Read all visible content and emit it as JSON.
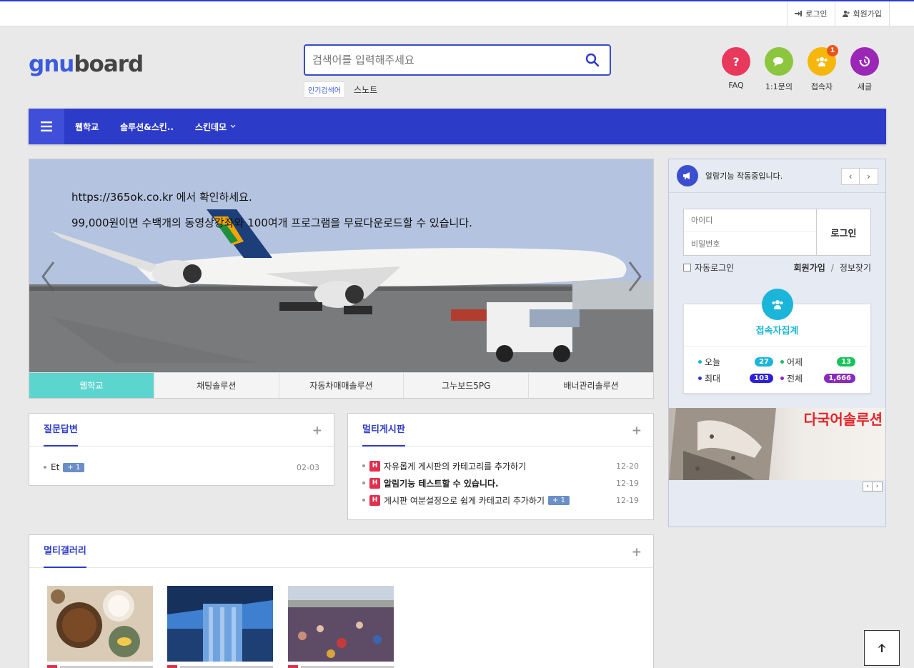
{
  "topbar": {
    "login_label": "로그인",
    "join_label": "회원가입"
  },
  "logo": {
    "part1": "gnu",
    "part2": "board"
  },
  "search": {
    "placeholder": "검색어를 입력해주세요",
    "popular_tag": "인기검색어",
    "popular_word": "스노트"
  },
  "quick_menu": [
    {
      "label": "FAQ",
      "icon": "question-icon",
      "color": "#e8385b"
    },
    {
      "label": "1:1문의",
      "icon": "chat-icon",
      "color": "#8cc63f"
    },
    {
      "label": "접속자",
      "icon": "users-icon",
      "color": "#f5b70c",
      "badge": "1"
    },
    {
      "label": "새글",
      "icon": "history-icon",
      "color": "#9b27b6"
    }
  ],
  "gnb": {
    "items": [
      "웹학교",
      "솔루션&스킨..",
      "스킨데모"
    ]
  },
  "slider": {
    "line1": "https://365ok.co.kr 에서 확인하세요.",
    "line2": "99,000원이면 수백개의 동영상강좌와 100여개 프로그램을 무료다운로드할 수 있습니다.",
    "tabs": [
      "웹학교",
      "채팅솔루션",
      "자동차매매솔루션",
      "그누보드5PG",
      "배너관리솔루션"
    ],
    "active_tab": 0
  },
  "qna": {
    "title": "질문답변",
    "posts": [
      {
        "title": "Et",
        "count": "+ 1",
        "date": "02-03"
      }
    ]
  },
  "multi_board": {
    "title": "멀티게시판",
    "posts": [
      {
        "badge": "H",
        "title": "자유롭게 게시판의 카테고리를 추가하기",
        "date": "12-20",
        "bold": false
      },
      {
        "badge": "H",
        "title": "알림기능 테스트할 수 있습니다.",
        "date": "12-19",
        "bold": true
      },
      {
        "badge": "H",
        "title": "게시판 여분설정으로 쉽게 카테고리 추가하기",
        "count": "+ 1",
        "date": "12-19",
        "bold": false
      }
    ]
  },
  "gallery": {
    "title": "멀티갤러리"
  },
  "sidebar": {
    "notice_text": "알람기능 작동중입니다.",
    "login": {
      "id_placeholder": "아이디",
      "pw_placeholder": "비밀번호",
      "login_button": "로그인",
      "auto_login": "자동로그인",
      "join": "회원가입",
      "separator": "/",
      "find": "정보찾기"
    },
    "visitors": {
      "title": "접속자집계",
      "today_label": "오늘",
      "today": "27",
      "yesterday_label": "어제",
      "yesterday": "13",
      "max_label": "최대",
      "max": "103",
      "total_label": "전체",
      "total": "1,666"
    },
    "banner_text": "다국어솔루션"
  },
  "colors": {
    "brand": "#2d3bc9",
    "accent_tab": "#5dd5cf",
    "hot_badge": "#e0304e"
  }
}
